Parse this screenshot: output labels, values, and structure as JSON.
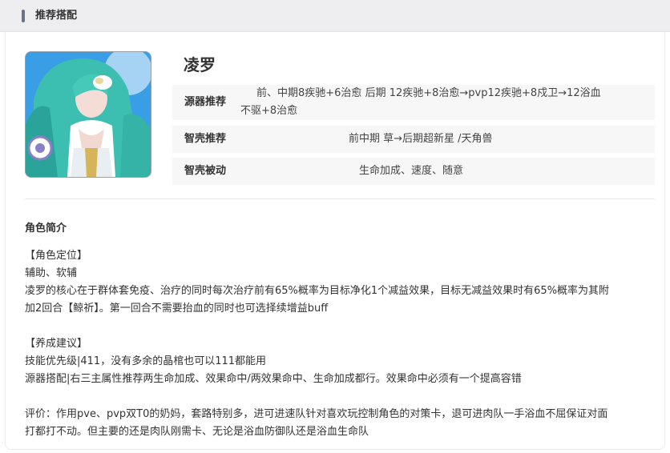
{
  "header": {
    "title": "推荐搭配"
  },
  "character": {
    "name": "凌罗"
  },
  "rows": [
    {
      "label": "源器推荐",
      "value_line1": "前、中期8疾驰+6治愈      后期 12疾驰+8治愈→pvp12疾驰+8戍卫→12浴血",
      "value_line2": "不驱+8治愈"
    },
    {
      "label": "智壳推荐",
      "value": "前中期 草→后期超新星 /天角兽"
    },
    {
      "label": "智壳被动",
      "value": "生命加成、速度、随意"
    }
  ],
  "intro": {
    "title": "角色简介",
    "lines": [
      "【角色定位】",
      "辅助、软辅",
      "凌罗的核心在于群体套免疫、治疗的同时每次治疗前有65%概率为目标净化1个减益效果，目标无减益效果时有65%概率为其附",
      "加2回合【鲸祈】。第一回合不需要抬血的同时也可选择续增益buff",
      "【养成建议】",
      "技能优先级|411，没有多余的晶棺也可以111都能用",
      "源器搭配|右三主属性推荐两生命加成、效果命中/两效果命中、生命加成都行。效果命中必须有一个提高容错",
      "评价：作用pve、pvp双T0的奶妈，套路特别多，进可进速队针对喜欢玩控制角色的对策卡，退可进肉队一手浴血不屈保证对面",
      "打都打不动。但主要的还是肉队刚需卡、无论是浴血防御队还是浴血生命队"
    ]
  }
}
